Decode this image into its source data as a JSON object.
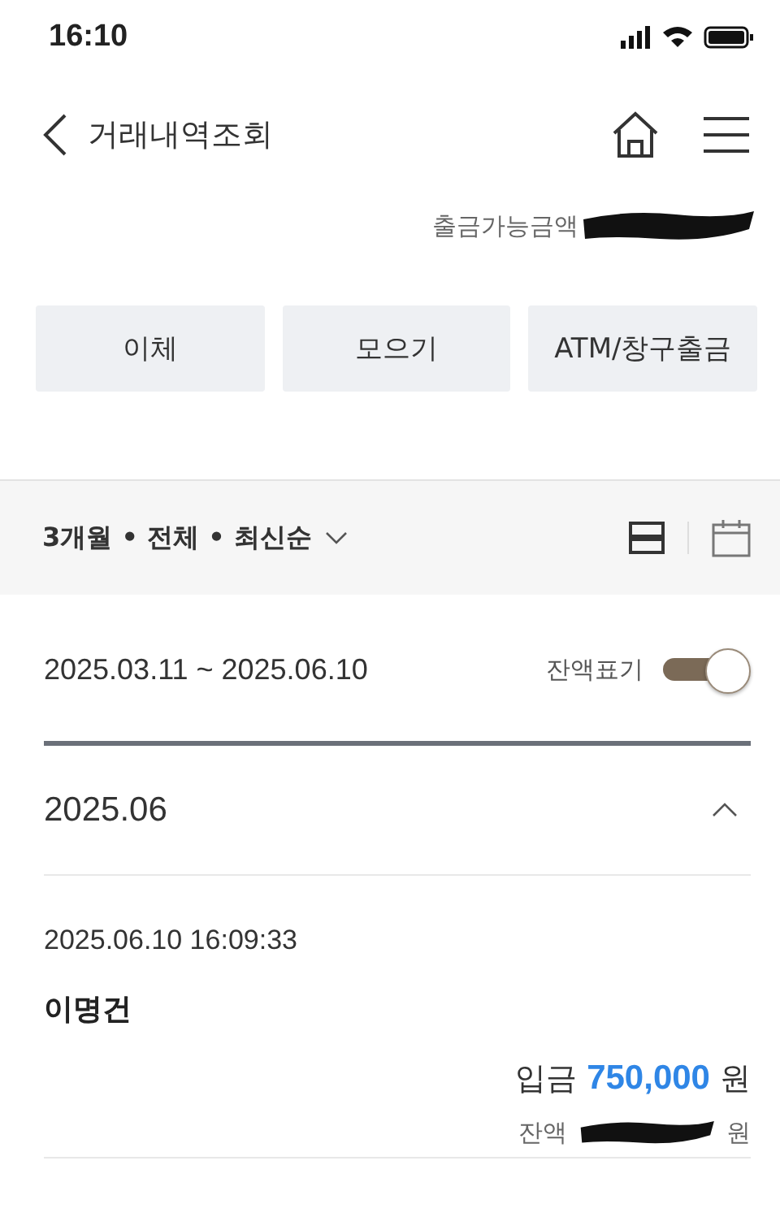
{
  "status_bar": {
    "time": "16:10"
  },
  "header": {
    "title": "거래내역조회"
  },
  "available": {
    "label": "출금가능금액"
  },
  "actions": [
    {
      "label": "이체"
    },
    {
      "label": "모으기"
    },
    {
      "label": "ATM/창구출금"
    }
  ],
  "filter": {
    "label": "3개월 • 전체 • 최신순"
  },
  "period": {
    "range": "2025.03.11 ~ 2025.06.10",
    "balance_toggle": {
      "label": "잔액표기",
      "on": true
    }
  },
  "months": [
    {
      "label": "2025.06",
      "expanded": true,
      "transactions": [
        {
          "time": "2025.06.10 16:09:33",
          "name": "이명건",
          "type": "입금",
          "amount": "750,000",
          "unit": "원",
          "balance_label": "잔액",
          "balance_unit": "원"
        }
      ]
    }
  ]
}
